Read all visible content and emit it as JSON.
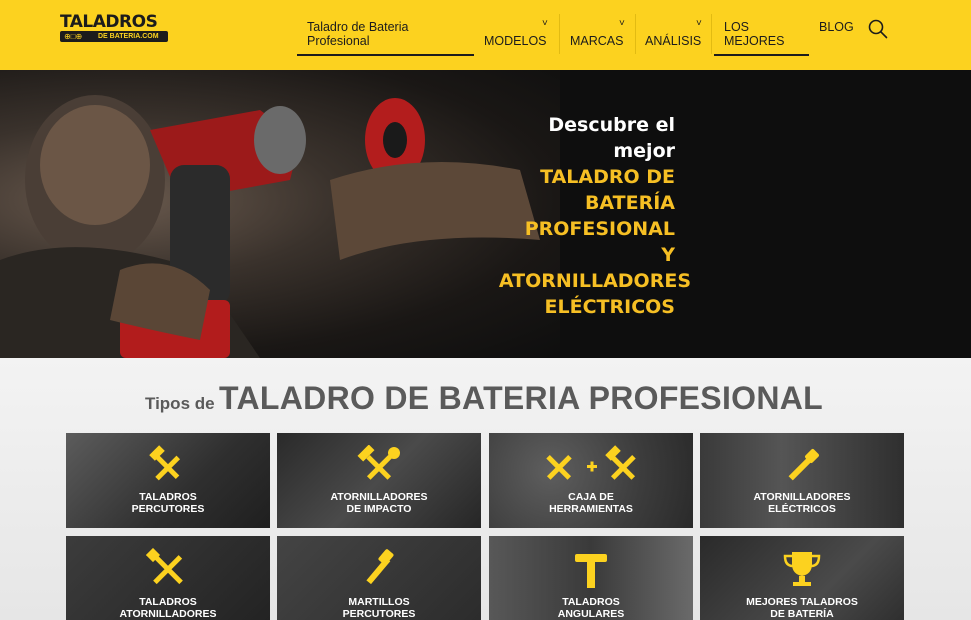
{
  "brand": {
    "logo_main": "TALADROS",
    "logo_dots": "⊕□⊕",
    "logo_sub": "DE BATERIA.COM",
    "accent_color": "#fcd21f",
    "highlight_color": "#f6bf24"
  },
  "nav": {
    "items": [
      {
        "label_line1": "Taladro de Bateria",
        "label_line2": "Profesional",
        "active": true
      },
      {
        "label": "MODELOS",
        "has_dropdown": true
      },
      {
        "label": "MARCAS",
        "has_dropdown": true
      },
      {
        "label": "ANÁLISIS",
        "has_dropdown": true
      },
      {
        "label_line1": "LOS",
        "label_line2": "MEJORES",
        "active": true
      },
      {
        "label": "BLOG"
      }
    ],
    "chevron": "˅",
    "search_icon": "search-icon"
  },
  "hero": {
    "line1": "Descubre el",
    "line2": "mejor",
    "line3": "TALADRO DE",
    "line4": "BATERÍA",
    "line5": "PROFESIONAL",
    "line6": "Y",
    "line7": "ATORNILLADORES",
    "line8": "ELÉCTRICOS"
  },
  "types": {
    "title_small": "Tipos de",
    "title_big": "TALADRO DE BATERIA PROFESIONAL",
    "tiles": [
      {
        "line1": "TALADROS",
        "line2": "PERCUTORES",
        "icon": "hammer-chisel-icon"
      },
      {
        "line1": "ATORNILLADORES",
        "line2": "DE IMPACTO",
        "icon": "hammer-wrench-icon"
      },
      {
        "line1": "CAJA DE",
        "line2": "HERRAMIENTAS",
        "icon": "tools-plus-icon"
      },
      {
        "line1": "ATORNILLADORES",
        "line2": "ELÉCTRICOS",
        "icon": "screwdriver-icon"
      },
      {
        "line1": "TALADROS",
        "line2": "ATORNILLADORES",
        "icon": "crossed-tools-icon"
      },
      {
        "line1": "MARTILLOS",
        "line2": "PERCUTORES",
        "icon": "hammer-drill-icon"
      },
      {
        "line1": "TALADROS",
        "line2": "ANGULARES",
        "icon": "angle-drill-icon"
      },
      {
        "line1": "MEJORES TALADROS",
        "line2": "DE BATERÍA",
        "icon": "trophy-icon"
      }
    ]
  }
}
